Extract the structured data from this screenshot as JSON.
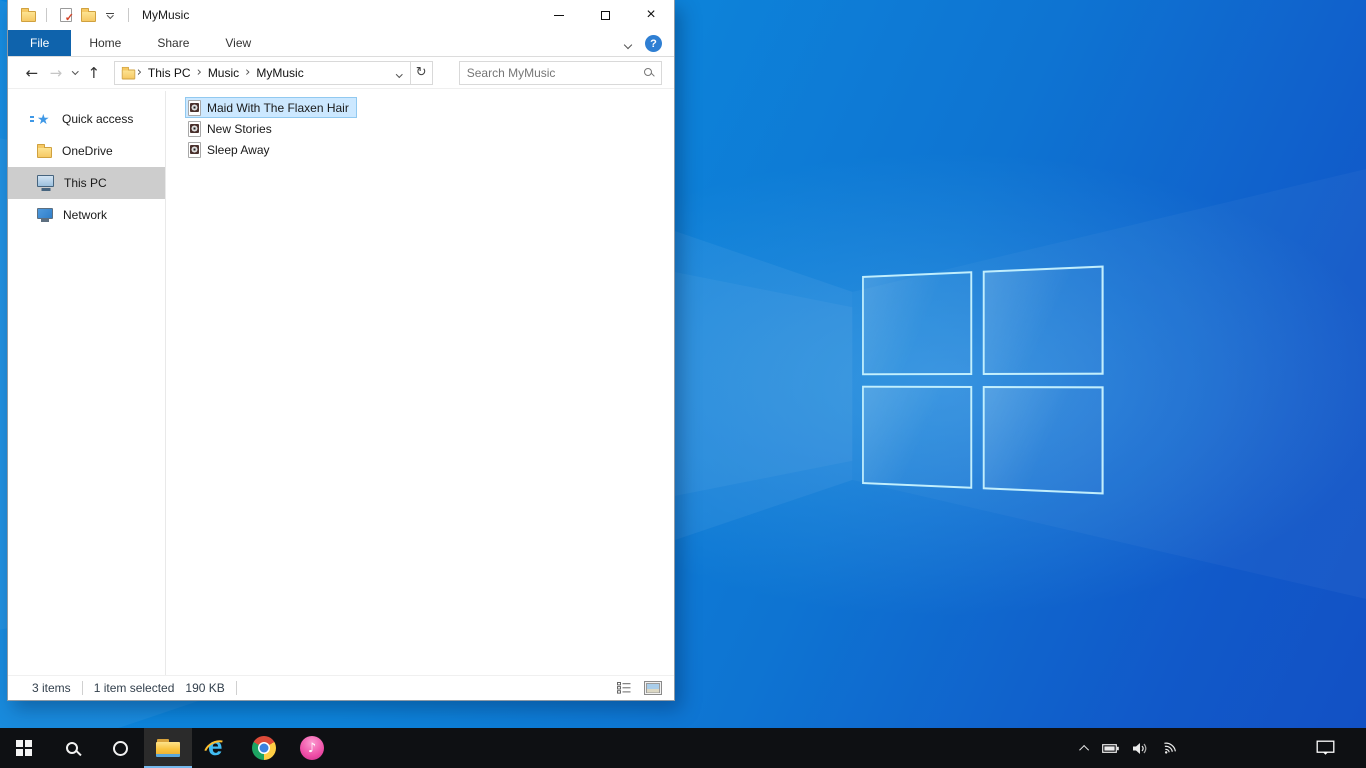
{
  "explorer": {
    "title": "MyMusic",
    "tabs": [
      {
        "label": "File",
        "active": true
      },
      {
        "label": "Home",
        "active": false
      },
      {
        "label": "Share",
        "active": false
      },
      {
        "label": "View",
        "active": false
      }
    ],
    "nav": {
      "breadcrumb": [
        {
          "label": "This PC"
        },
        {
          "label": "Music"
        },
        {
          "label": "MyMusic"
        }
      ]
    },
    "search": {
      "placeholder": "Search MyMusic"
    },
    "sidebar": {
      "items": [
        {
          "label": "Quick access",
          "icon": "quick-access-star",
          "selected": false
        },
        {
          "label": "OneDrive",
          "icon": "folder",
          "selected": false
        },
        {
          "label": "This PC",
          "icon": "monitor",
          "selected": true
        },
        {
          "label": "Network",
          "icon": "network",
          "selected": false
        }
      ]
    },
    "files": {
      "items": [
        {
          "name": "Maid With The Flaxen Hair",
          "icon": "music-file",
          "selected": true
        },
        {
          "name": "New Stories",
          "icon": "music-file",
          "selected": false
        },
        {
          "name": "Sleep Away",
          "icon": "music-file",
          "selected": false
        }
      ]
    },
    "status": {
      "items_count": "3 items",
      "selection": "1 item selected",
      "selection_size": "190 KB"
    }
  },
  "taskbar": {
    "buttons": [
      {
        "name": "start"
      },
      {
        "name": "search"
      },
      {
        "name": "cortana"
      },
      {
        "name": "file-explorer",
        "active": true
      },
      {
        "name": "internet-explorer"
      },
      {
        "name": "chrome"
      },
      {
        "name": "itunes"
      }
    ],
    "tray_icons": [
      "hidden-icons-chevron",
      "battery",
      "volume",
      "wifi"
    ],
    "action_center": "action-center"
  },
  "glyphs": {
    "back": "←",
    "forward": "→",
    "up": "↑",
    "refresh": "↻",
    "breadcrumb_separator": "›",
    "close": "×",
    "help": "?",
    "music_note": "♪",
    "ie_e": "e",
    "properties_check": "✓"
  },
  "colors": {
    "file_tab_blue": "#0f63ac",
    "selection_bg": "#cce8ff",
    "selection_border": "#91c9f0",
    "sidebar_selected": "#cdcdcd",
    "taskbar_bg": "#0e1013",
    "taskbar_active_underline": "#76b9ed",
    "wallpaper_base": "#0d84da",
    "wallpaper_corner": "#1250c4",
    "logo_line": "#cdf6ff",
    "folder_yellow": "#f6c964"
  }
}
